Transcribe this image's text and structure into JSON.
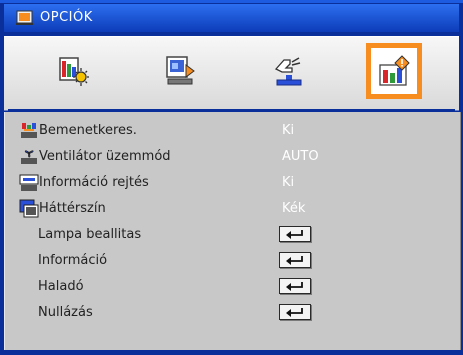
{
  "menu": {
    "title": "OPCIÓK",
    "colors": {
      "frame": "#0a2f9a",
      "active_tab": "#f78d1e",
      "panel": "#c8c8c8",
      "value_text": "#ffffff"
    },
    "tabs": [
      {
        "icon": "image-settings-icon"
      },
      {
        "icon": "display-settings-icon"
      },
      {
        "icon": "setup-settings-icon"
      },
      {
        "icon": "options-icon",
        "active": true
      }
    ],
    "items": [
      {
        "label": "Bemenetkeres.",
        "value": "Ki",
        "icon": "source-lock-icon"
      },
      {
        "label": "Ventilátor üzemmód",
        "value": "AUTO",
        "icon": "fan-mode-icon"
      },
      {
        "label": "Információ rejtés",
        "value": "Ki",
        "icon": "info-hide-icon"
      },
      {
        "label": "Háttérszín",
        "value": "Kék",
        "icon": "background-color-icon"
      },
      {
        "label": "Lampa beallitas",
        "icon": "enter-icon"
      },
      {
        "label": "Információ",
        "icon": "enter-icon"
      },
      {
        "label": "Haladó",
        "icon": "enter-icon"
      },
      {
        "label": "Nullázás",
        "icon": "enter-icon"
      }
    ]
  }
}
